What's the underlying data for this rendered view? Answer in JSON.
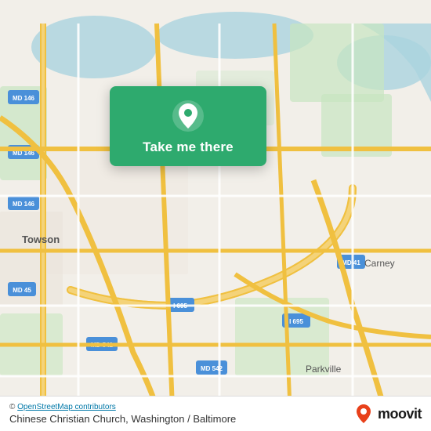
{
  "map": {
    "attribution": "© OpenStreetMap contributors",
    "osm_link_text": "OpenStreetMap contributors"
  },
  "card": {
    "button_label": "Take me there",
    "pin_icon": "location-pin"
  },
  "bottom_bar": {
    "attribution": "© ",
    "attribution_link": "OpenStreetMap contributors",
    "church_name": "Chinese Christian Church, Washington / Baltimore",
    "moovit_text": "moovit"
  },
  "roads": {
    "color_primary": "#f7c94b",
    "color_secondary": "#ffffff",
    "color_tertiary": "#e8e0d0"
  }
}
